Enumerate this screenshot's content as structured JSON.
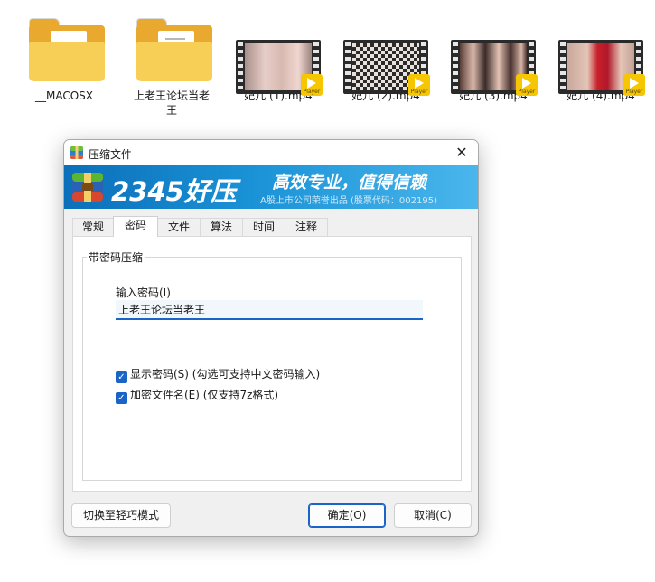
{
  "files": [
    {
      "label": "__MACOSX",
      "type": "folder"
    },
    {
      "label": "上老王论坛当老王",
      "type": "folder"
    },
    {
      "label": "妃儿 (1).mp4",
      "type": "video"
    },
    {
      "label": "妃儿 (2).mp4",
      "type": "video"
    },
    {
      "label": "妃儿 (3).mp4",
      "type": "video"
    },
    {
      "label": "妃儿 (4).mp4",
      "type": "video"
    }
  ],
  "video_badge_text": "Player",
  "dialog": {
    "title": "压缩文件",
    "close_glyph": "✕",
    "banner": {
      "brand": "2345好压",
      "slogan": "高效专业，值得信赖",
      "subtitle": "A股上市公司荣誉出品 (股票代码：002195)"
    },
    "tabs": [
      "常规",
      "密码",
      "文件",
      "算法",
      "时间",
      "注释"
    ],
    "active_tab": 1,
    "group_title": "带密码压缩",
    "password_label": "输入密码(I)",
    "password_value": "上老王论坛当老王",
    "checkboxes": [
      {
        "label": "显示密码(S) (勾选可支持中文密码输入)",
        "checked": true
      },
      {
        "label": "加密文件名(E) (仅支持7z格式)",
        "checked": true
      }
    ],
    "buttons": {
      "switch_mode": "切换至轻巧模式",
      "ok": "确定(O)",
      "cancel": "取消(C)"
    }
  },
  "colors": {
    "accent": "#1b64c7",
    "folder_front": "#f8cf56",
    "folder_back": "#e8a92e",
    "banner_start": "#0c6fba",
    "banner_end": "#4ab6ec",
    "badge": "#f6c600"
  },
  "icons": {
    "folder": "folder-icon",
    "video": "video-file-icon",
    "app": "archive-app-icon",
    "close": "close-icon",
    "check": "checkmark-icon"
  }
}
